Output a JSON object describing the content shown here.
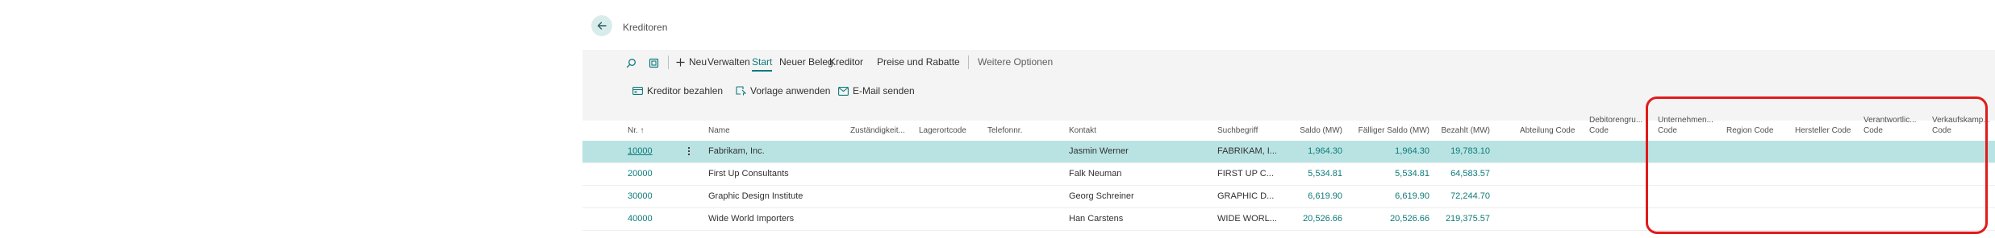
{
  "page": {
    "title": "Kreditoren"
  },
  "toolbar": {
    "new_label": "Neu",
    "actions": [
      "Verwalten",
      "Start",
      "Neuer Beleg",
      "Kreditor",
      "Preise und Rabatte"
    ],
    "more_label": "Weitere Optionen",
    "sub_actions": [
      "Kreditor bezahlen",
      "Vorlage anwenden",
      "E-Mail senden"
    ]
  },
  "grid": {
    "headers": {
      "nr": "Nr. ↑",
      "name": "Name",
      "zust": "Zuständigkeit...",
      "lager": "Lagerortcode",
      "tel": "Telefonnr.",
      "kontakt": "Kontakt",
      "such": "Suchbegriff",
      "saldo": "Saldo (MW)",
      "faellig": "Fälliger Saldo (MW)",
      "bezahlt": "Bezahlt (MW)",
      "abteilung": "Abteilung Code",
      "debitor_l1": "Debitorengru...",
      "debitor_l2": "Code",
      "unternehmen_l1": "Unternehmen...",
      "unternehmen_l2": "Code",
      "region": "Region Code",
      "hersteller": "Hersteller Code",
      "verantwort_l1": "Verantwortlic...",
      "verantwort_l2": "Code",
      "verkauf_l1": "Verkaufskamp...",
      "verkauf_l2": "Code"
    },
    "rows": [
      {
        "nr": "10000",
        "name": "Fabrikam, Inc.",
        "kontakt": "Jasmin Werner",
        "such": "FABRIKAM, I...",
        "saldo": "1,964.30",
        "faellig": "1,964.30",
        "bezahlt": "19,783.10"
      },
      {
        "nr": "20000",
        "name": "First Up Consultants",
        "kontakt": "Falk Neuman",
        "such": "FIRST UP C...",
        "saldo": "5,534.81",
        "faellig": "5,534.81",
        "bezahlt": "64,583.57"
      },
      {
        "nr": "30000",
        "name": "Graphic Design Institute",
        "kontakt": "Georg Schreiner",
        "such": "GRAPHIC D...",
        "saldo": "6,619.90",
        "faellig": "6,619.90",
        "bezahlt": "72,244.70"
      },
      {
        "nr": "40000",
        "name": "Wide World Importers",
        "kontakt": "Han Carstens",
        "such": "WIDE WORL...",
        "saldo": "20,526.66",
        "faellig": "20,526.66",
        "bezahlt": "219,375.57"
      }
    ]
  },
  "colors": {
    "accent": "#0f7a7a",
    "selected_row": "#b9e3e3",
    "highlight": "#e01b1b"
  }
}
